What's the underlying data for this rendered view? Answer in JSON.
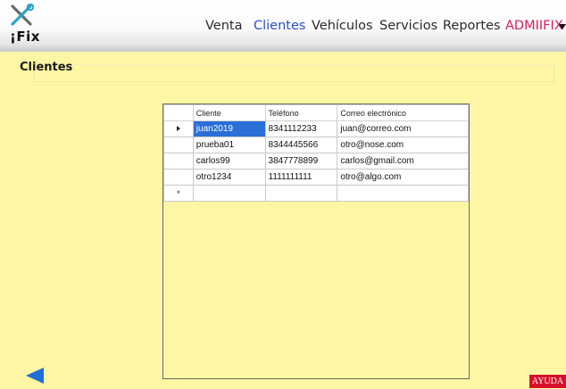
{
  "app": {
    "logo_text": "¡Fix"
  },
  "nav": {
    "items": [
      "Venta",
      "Clientes",
      "Vehículos",
      "Servicios",
      "Reportes"
    ],
    "active": "Clientes",
    "user": "ADMIIFIX"
  },
  "page": {
    "title": "Clientes"
  },
  "table": {
    "columns": [
      "Cliente",
      "Teléfono",
      "Correo electrónico"
    ],
    "rows": [
      [
        "juan2019",
        "8341112233",
        "juan@correo.com"
      ],
      [
        "prueba01",
        "8344445566",
        "otro@nose.com"
      ],
      [
        "carlos99",
        "3847778899",
        "carlos@gmail.com"
      ],
      [
        "otro1234",
        "1111111111",
        "otro@algo.com"
      ]
    ],
    "new_row_marker": "*",
    "selected_cell": "juan2019"
  },
  "footer": {
    "help_label": "AYUDA"
  },
  "colors": {
    "background": "#fdf6a4",
    "active_nav": "#2a4fc9",
    "user_menu": "#d6205b",
    "back_arrow": "#1e6fd6",
    "help_button": "#d8102a",
    "selection": "#2a6fd6"
  },
  "icons": [
    "tools-icon",
    "back-arrow-icon",
    "chevron-down-icon",
    "row-pointer-icon"
  ]
}
